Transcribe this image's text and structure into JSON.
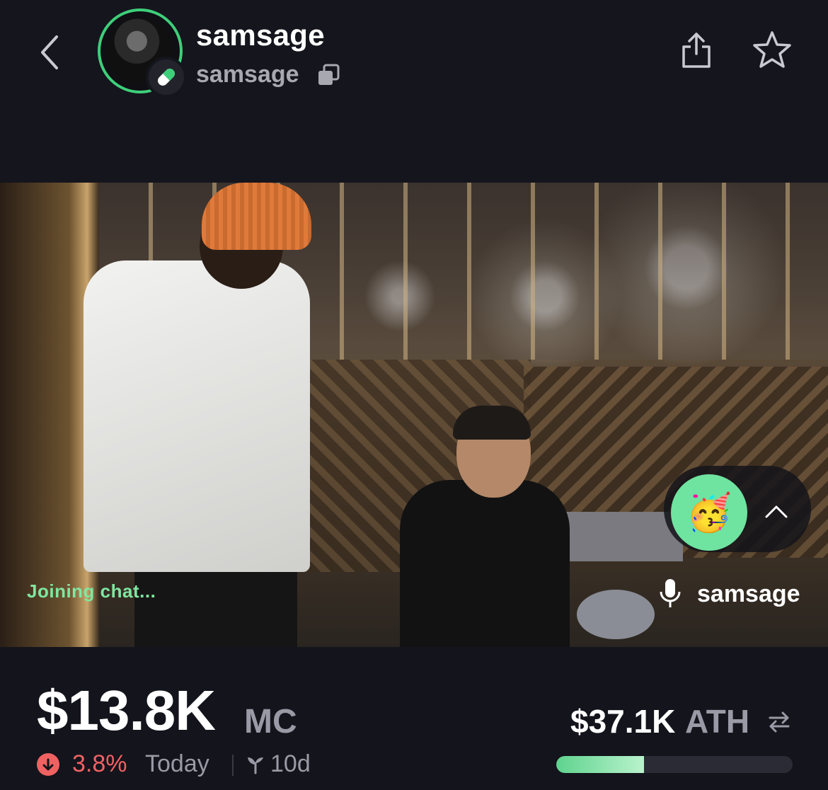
{
  "header": {
    "title": "samsage",
    "subtitle": "samsage",
    "icons": {
      "back": "chevron-left-icon",
      "badge": "pill-icon",
      "copy": "copy-icon",
      "share": "share-icon",
      "favorite": "star-icon"
    }
  },
  "stream": {
    "status": "Joining chat...",
    "speaker": "samsage",
    "reaction_emoji": "🥳",
    "icons": {
      "mic": "microphone-icon",
      "expand": "chevron-up-icon"
    }
  },
  "stats": {
    "market_cap": "$13.8K",
    "market_cap_unit": "MC",
    "change_value": "3.8%",
    "change_label": "Today",
    "change_direction": "down",
    "age": "10d",
    "ath_value": "$37.1K",
    "ath_label": "ATH",
    "ath_progress": 0.37
  },
  "colors": {
    "background": "#14141c",
    "accent_green": "#3ecf7a",
    "status_green": "#7fe7a0",
    "negative_red": "#f06262",
    "muted_text": "#9a9aa6"
  }
}
